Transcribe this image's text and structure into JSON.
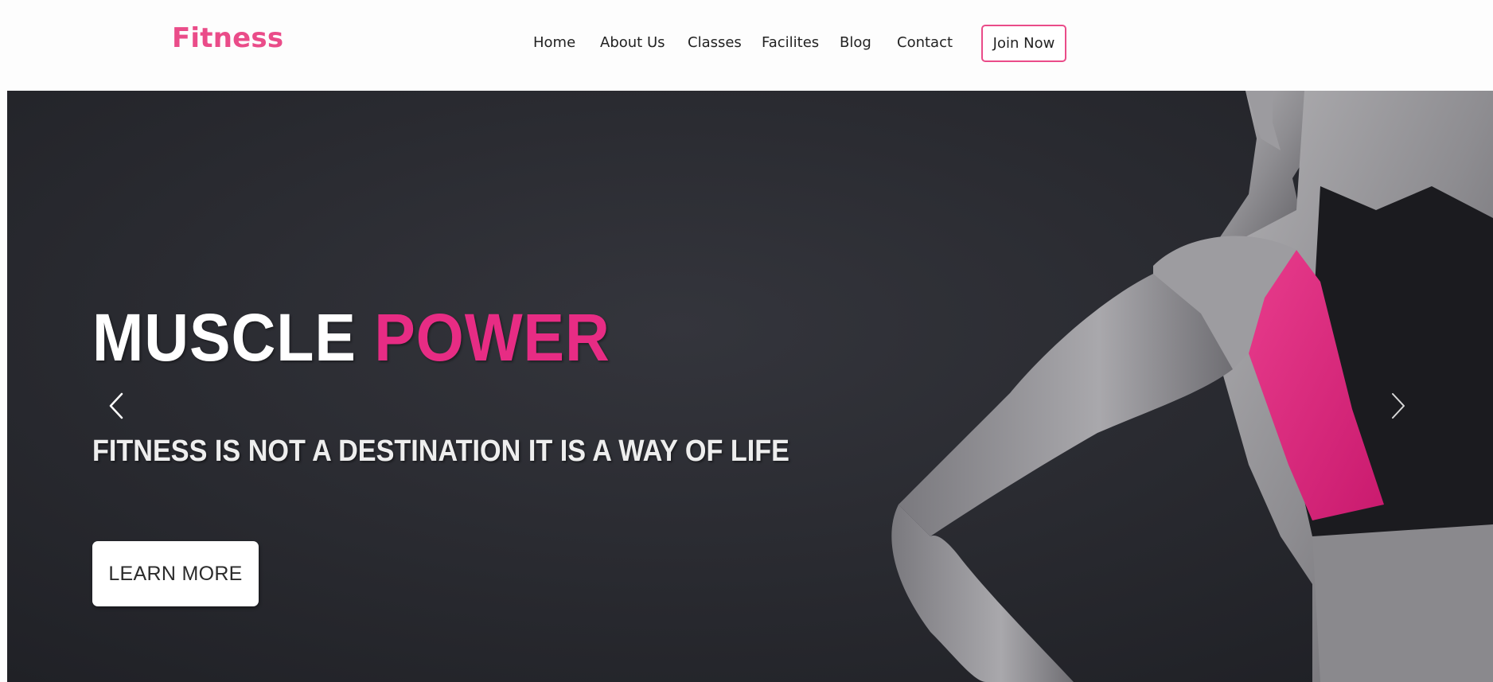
{
  "navbar": {
    "brand": "Fitness",
    "links": [
      "Home",
      "About Us",
      "Classes",
      "Facilites",
      "Blog",
      "Contact"
    ],
    "join_label": "Join Now"
  },
  "hero": {
    "title_main": "MUSCLE ",
    "title_accent": "POWER",
    "subtitle": "FITNESS IS NOT A DESTINATION IT IS A WAY OF LIFE",
    "cta_label": "LEARN MORE",
    "prev_icon": "chevron-left-icon",
    "next_icon": "chevron-right-icon"
  },
  "colors": {
    "brand": "#ea4c89",
    "accent": "#e72c84",
    "hero_background": "#2a2b31"
  }
}
